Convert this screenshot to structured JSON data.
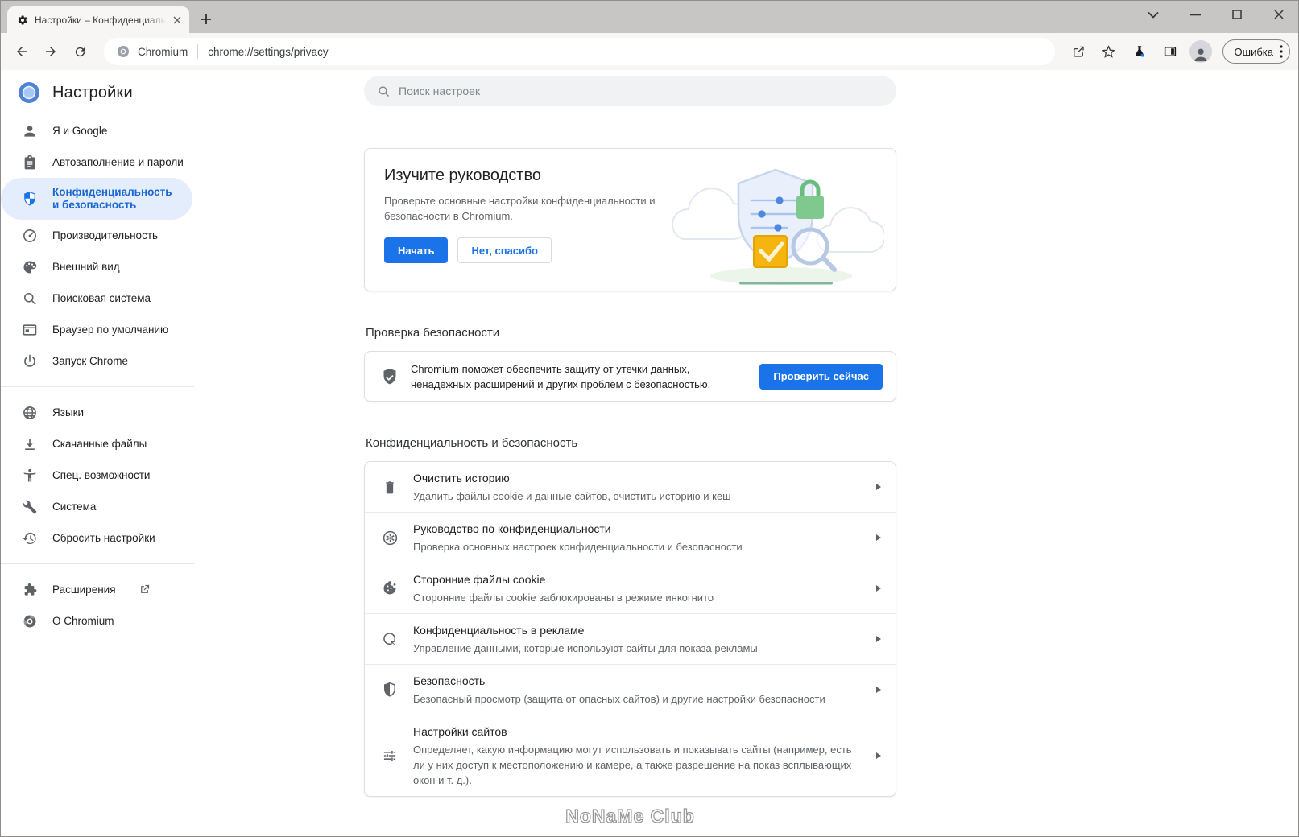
{
  "window": {
    "tab_title": "Настройки – Конфиденциальн",
    "error_button": "Ошибка"
  },
  "toolbar": {
    "site_label": "Chromium",
    "url": "chrome://settings/privacy"
  },
  "sidebar": {
    "title": "Настройки",
    "items": [
      {
        "icon": "person-icon",
        "label": "Я и Google"
      },
      {
        "icon": "autofill-icon",
        "label": "Автозаполнение и пароли"
      },
      {
        "icon": "shield-icon",
        "label": "Конфиденциальность и безопасность",
        "selected": true
      },
      {
        "icon": "speedometer-icon",
        "label": "Производительность"
      },
      {
        "icon": "palette-icon",
        "label": "Внешний вид"
      },
      {
        "icon": "search-icon",
        "label": "Поисковая система"
      },
      {
        "icon": "browser-icon",
        "label": "Браузер по умолчанию"
      },
      {
        "icon": "power-icon",
        "label": "Запуск Chrome"
      }
    ],
    "tools": [
      {
        "icon": "globe-icon",
        "label": "Языки"
      },
      {
        "icon": "download-icon",
        "label": "Скачанные файлы"
      },
      {
        "icon": "accessibility-icon",
        "label": "Спец. возможности"
      },
      {
        "icon": "wrench-icon",
        "label": "Система"
      },
      {
        "icon": "restore-icon",
        "label": "Сбросить настройки"
      }
    ],
    "footer": [
      {
        "icon": "puzzle-icon",
        "label": "Расширения",
        "external": true
      },
      {
        "icon": "chromium-icon",
        "label": "О Chromium"
      }
    ]
  },
  "search": {
    "placeholder": "Поиск настроек"
  },
  "guide_card": {
    "title": "Изучите руководство",
    "body": "Проверьте основные настройки конфиденциальности и безопасности в Chromium.",
    "primary_button": "Начать",
    "secondary_button": "Нет, спасибо"
  },
  "safety_check": {
    "header": "Проверка безопасности",
    "text": "Chromium поможет обеспечить защиту от утечки данных, ненадежных расширений и других проблем с безопасностью.",
    "button": "Проверить сейчас"
  },
  "privacy": {
    "header": "Конфиденциальность и безопасность",
    "rows": [
      {
        "icon": "trash-icon",
        "title": "Очистить историю",
        "subtitle": "Удалить файлы cookie и данные сайтов, очистить историю и кеш"
      },
      {
        "icon": "privacy-guide-icon",
        "title": "Руководство по конфиденциальности",
        "subtitle": "Проверка основных настроек конфиденциальности и безопасности"
      },
      {
        "icon": "cookie-icon",
        "title": "Сторонние файлы cookie",
        "subtitle": "Сторонние файлы cookie заблокированы в режиме инкогнито"
      },
      {
        "icon": "ads-click-icon",
        "title": "Конфиденциальность в рекламе",
        "subtitle": "Управление данными, которые используют сайты для показа рекламы"
      },
      {
        "icon": "security-shield-icon",
        "title": "Безопасность",
        "subtitle": "Безопасный просмотр (защита от опасных сайтов) и другие настройки безопасности"
      },
      {
        "icon": "tune-icon",
        "title": "Настройки сайтов",
        "subtitle": "Определяет, какую информацию могут использовать и показывать сайты (например, есть ли у них доступ к местоположению и камере, а также разрешение на показ всплывающих окон и т. д.)."
      }
    ]
  },
  "watermark": "NoNaMe Club",
  "colors": {
    "accent_blue": "#1a73e8",
    "selected_blue": "#1967d2",
    "selected_bg": "#e4edfb",
    "titlebar": "#c8c6c5",
    "toolbar": "#f7f6f4",
    "secondary_text": "#5f6368",
    "lock_green": "#7fc98f",
    "check_amber": "#f6b40e"
  }
}
